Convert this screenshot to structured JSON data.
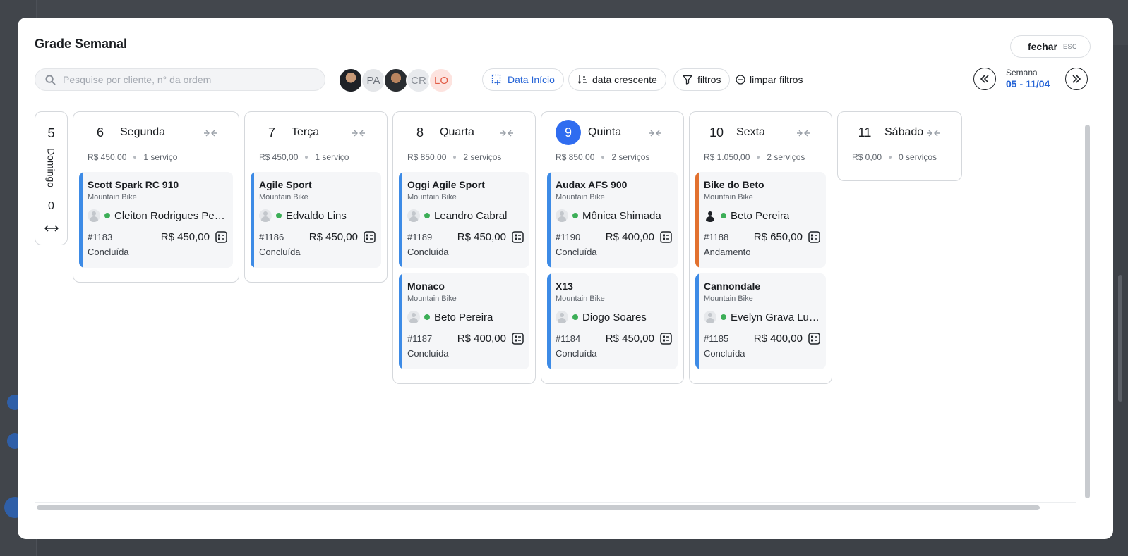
{
  "modal": {
    "title": "Grade Semanal",
    "close_label": "fechar",
    "close_key": "ESC"
  },
  "toolbar": {
    "search_placeholder": "Pesquise por cliente, n° da ordem",
    "avatars": [
      {
        "type": "photo",
        "initials": ""
      },
      {
        "type": "initials",
        "initials": "PA"
      },
      {
        "type": "photo",
        "initials": ""
      },
      {
        "type": "initials",
        "initials": "CR"
      },
      {
        "type": "initials",
        "initials": "LO"
      }
    ],
    "date_filter_label": "Data Início",
    "sort_label": "data crescente",
    "filters_label": "filtros",
    "clear_filters_label": "limpar filtros"
  },
  "week": {
    "label": "Semana",
    "range": "05 - 11/04"
  },
  "collapsed_day": {
    "number": "5",
    "name": "Domingo",
    "count": "0"
  },
  "days": [
    {
      "number": "6",
      "name": "Segunda",
      "total": "R$ 450,00",
      "services": "1 serviço",
      "today": false,
      "cards": [
        {
          "title": "Scott Spark RC 910",
          "category": "Mountain Bike",
          "person": "Cleiton Rodrigues Pereira",
          "avatar": "placeholder",
          "order": "#1183",
          "price": "R$ 450,00",
          "status": "Concluída",
          "accent": "#3d8be6"
        }
      ]
    },
    {
      "number": "7",
      "name": "Terça",
      "total": "R$ 450,00",
      "services": "1 serviço",
      "today": false,
      "cards": [
        {
          "title": "Agile Sport",
          "category": "Mountain Bike",
          "person": "Edvaldo Lins",
          "avatar": "placeholder",
          "order": "#1186",
          "price": "R$ 450,00",
          "status": "Concluída",
          "accent": "#3d8be6"
        }
      ]
    },
    {
      "number": "8",
      "name": "Quarta",
      "total": "R$ 850,00",
      "services": "2 serviços",
      "today": false,
      "cards": [
        {
          "title": "Oggi Agile Sport",
          "category": "Mountain Bike",
          "person": "Leandro Cabral",
          "avatar": "placeholder",
          "order": "#1189",
          "price": "R$ 450,00",
          "status": "Concluída",
          "accent": "#3d8be6"
        },
        {
          "title": "Monaco",
          "category": "Mountain Bike",
          "person": "Beto Pereira",
          "avatar": "placeholder",
          "order": "#1187",
          "price": "R$ 400,00",
          "status": "Concluída",
          "accent": "#3d8be6"
        }
      ]
    },
    {
      "number": "9",
      "name": "Quinta",
      "total": "R$ 850,00",
      "services": "2 serviços",
      "today": true,
      "cards": [
        {
          "title": "Audax AFS 900",
          "category": "Mountain Bike",
          "person": "Mônica Shimada",
          "avatar": "placeholder",
          "order": "#1190",
          "price": "R$ 400,00",
          "status": "Concluída",
          "accent": "#3d8be6"
        },
        {
          "title": "X13",
          "category": "Mountain Bike",
          "person": "Diogo Soares",
          "avatar": "placeholder",
          "order": "#1184",
          "price": "R$ 450,00",
          "status": "Concluída",
          "accent": "#3d8be6"
        }
      ]
    },
    {
      "number": "10",
      "name": "Sexta",
      "total": "R$ 1.050,00",
      "services": "2 serviços",
      "today": false,
      "cards": [
        {
          "title": "Bike do Beto",
          "category": "Mountain Bike",
          "person": "Beto Pereira",
          "avatar": "dark",
          "order": "#1188",
          "price": "R$ 650,00",
          "status": "Andamento",
          "accent": "#e2712f"
        },
        {
          "title": "Cannondale",
          "category": "Mountain Bike",
          "person": "Evelyn Grava Luppi",
          "avatar": "placeholder",
          "order": "#1185",
          "price": "R$ 400,00",
          "status": "Concluída",
          "accent": "#3d8be6"
        }
      ]
    },
    {
      "number": "11",
      "name": "Sábado",
      "total": "R$ 0,00",
      "services": "0 serviços",
      "today": false,
      "cards": []
    }
  ]
}
